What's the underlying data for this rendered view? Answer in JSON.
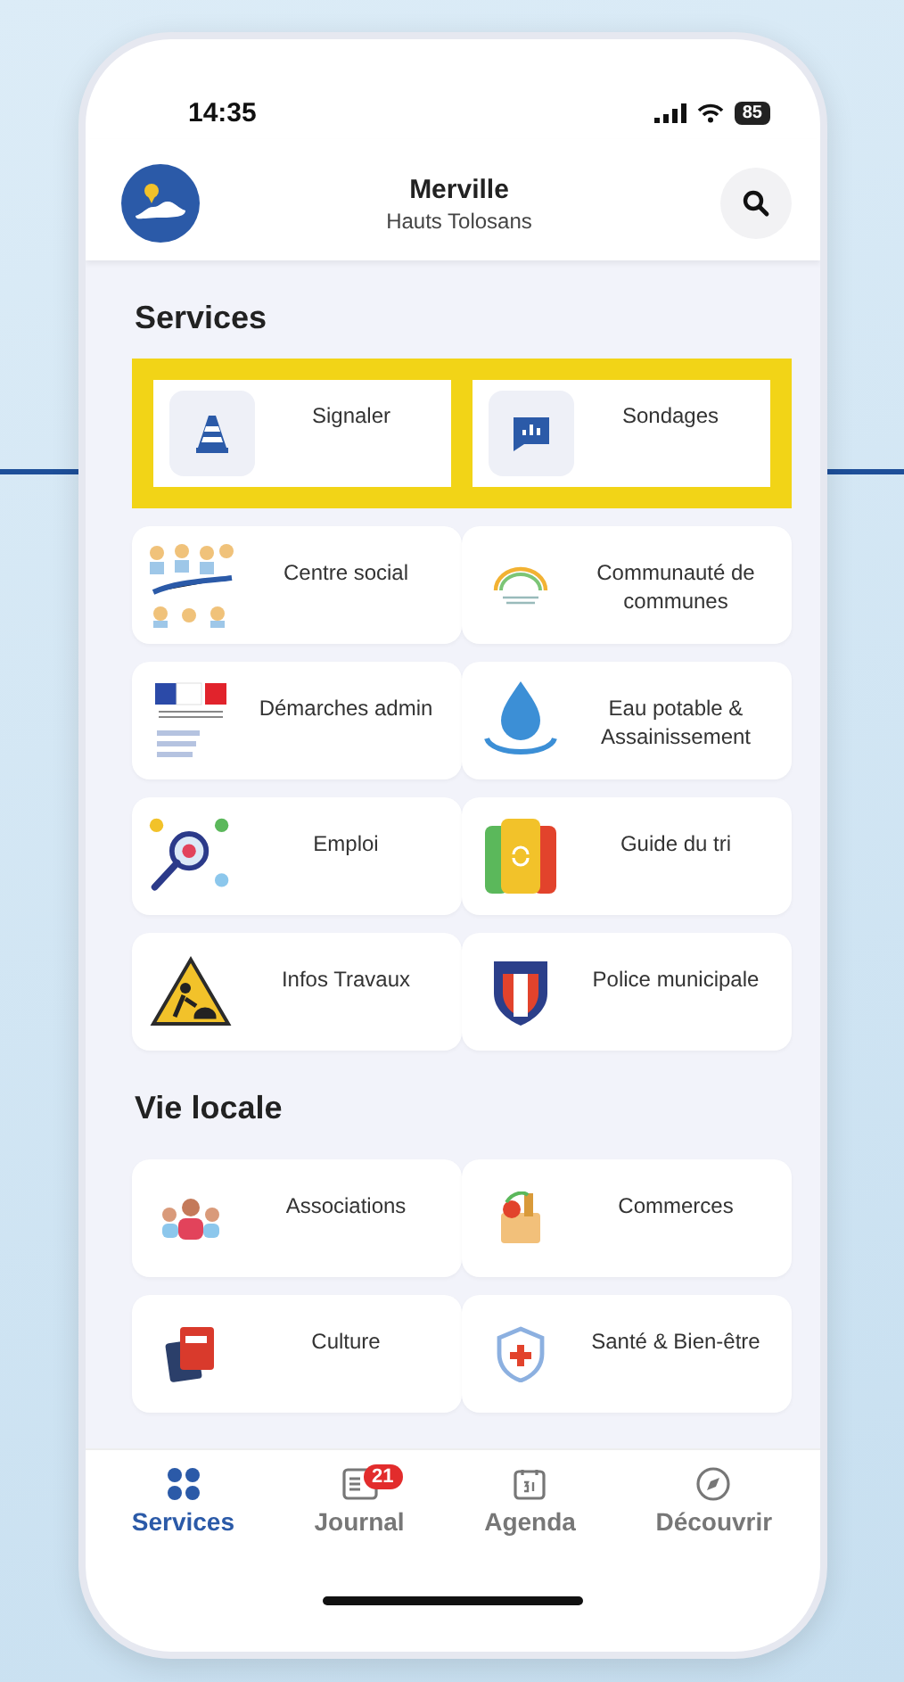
{
  "status_bar": {
    "time": "14:35",
    "battery": "85"
  },
  "header": {
    "title": "Merville",
    "subtitle": "Hauts Tolosans"
  },
  "sections": [
    {
      "title": "Services",
      "tiles": [
        {
          "label": "Signaler",
          "highlighted": true
        },
        {
          "label": "Sondages",
          "highlighted": true
        },
        {
          "label": "Centre social",
          "highlighted": false
        },
        {
          "label": "Communauté de communes",
          "highlighted": false
        },
        {
          "label": "Démarches admin",
          "highlighted": false
        },
        {
          "label": "Eau potable & Assainissement",
          "highlighted": false
        },
        {
          "label": "Emploi",
          "highlighted": false
        },
        {
          "label": "Guide du tri",
          "highlighted": false
        },
        {
          "label": "Infos Travaux",
          "highlighted": false
        },
        {
          "label": "Police municipale",
          "highlighted": false
        }
      ]
    },
    {
      "title": "Vie locale",
      "tiles": [
        {
          "label": "Associations",
          "highlighted": false
        },
        {
          "label": "Commerces",
          "highlighted": false
        },
        {
          "label": "Culture",
          "highlighted": false
        },
        {
          "label": "Santé & Bien-être",
          "highlighted": false
        }
      ]
    }
  ],
  "nav": [
    {
      "label": "Services",
      "selected": true
    },
    {
      "label": "Journal",
      "selected": false,
      "badge": "21"
    },
    {
      "label": "Agenda",
      "selected": false
    },
    {
      "label": "Découvrir",
      "selected": false
    }
  ]
}
